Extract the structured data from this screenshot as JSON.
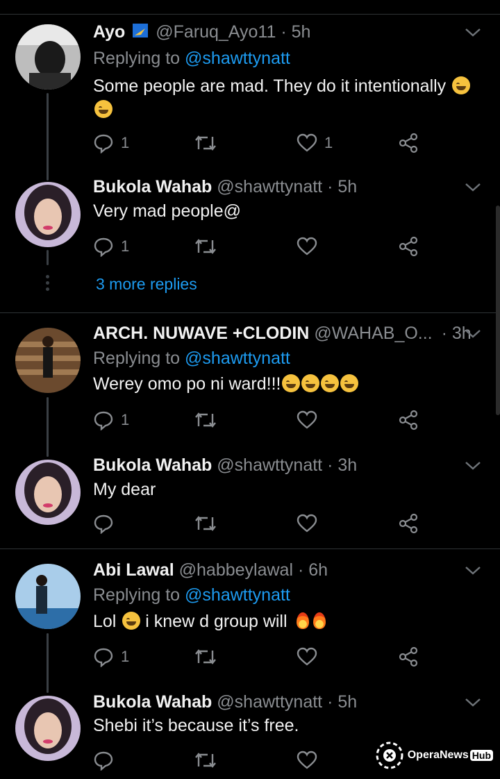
{
  "tweets": [
    {
      "name": "Ayo",
      "badge": "✈",
      "handle": "@Faruq_Ayo11",
      "time": "5h",
      "replying_prefix": "Replying to",
      "replying_to": "@shawttynatt",
      "text": "Some people are mad. They do it intentionally",
      "reply_count": "1",
      "like_count": "1"
    },
    {
      "name": "Bukola Wahab",
      "handle": "@shawttynatt",
      "time": "5h",
      "text": "Very mad people@",
      "reply_count": "1",
      "like_count": ""
    },
    {
      "name": "ARCH. NUWAVE +CLODIN",
      "handle": "@WAHAB_O...",
      "time": "3h",
      "replying_prefix": "Replying to",
      "replying_to": "@shawttynatt",
      "text": "Werey omo po ni ward!!!",
      "reply_count": "1",
      "like_count": ""
    },
    {
      "name": "Bukola Wahab",
      "handle": "@shawttynatt",
      "time": "3h",
      "text": "My dear",
      "reply_count": "",
      "like_count": ""
    },
    {
      "name": "Abi Lawal",
      "handle": "@habbeylawal",
      "time": "6h",
      "replying_prefix": "Replying to",
      "replying_to": "@shawttynatt",
      "text_a": "Lol",
      "text_b": "i knew d group will",
      "reply_count": "1",
      "like_count": ""
    },
    {
      "name": "Bukola Wahab",
      "handle": "@shawttynatt",
      "time": "5h",
      "text": "Shebi it’s because it’s free.",
      "reply_count": "",
      "like_count": ""
    }
  ],
  "more_replies": "3 more replies",
  "watermark": {
    "text": "OperaNews",
    "hub": "Hub"
  },
  "separator": "·",
  "icons": [
    "reply-icon",
    "retweet-icon",
    "like-icon",
    "share-icon",
    "chevron-down-icon"
  ],
  "colors": {
    "background": "#000000",
    "accent": "#1d9bf0",
    "muted": "#8a8d91",
    "line": "#2f3336"
  }
}
